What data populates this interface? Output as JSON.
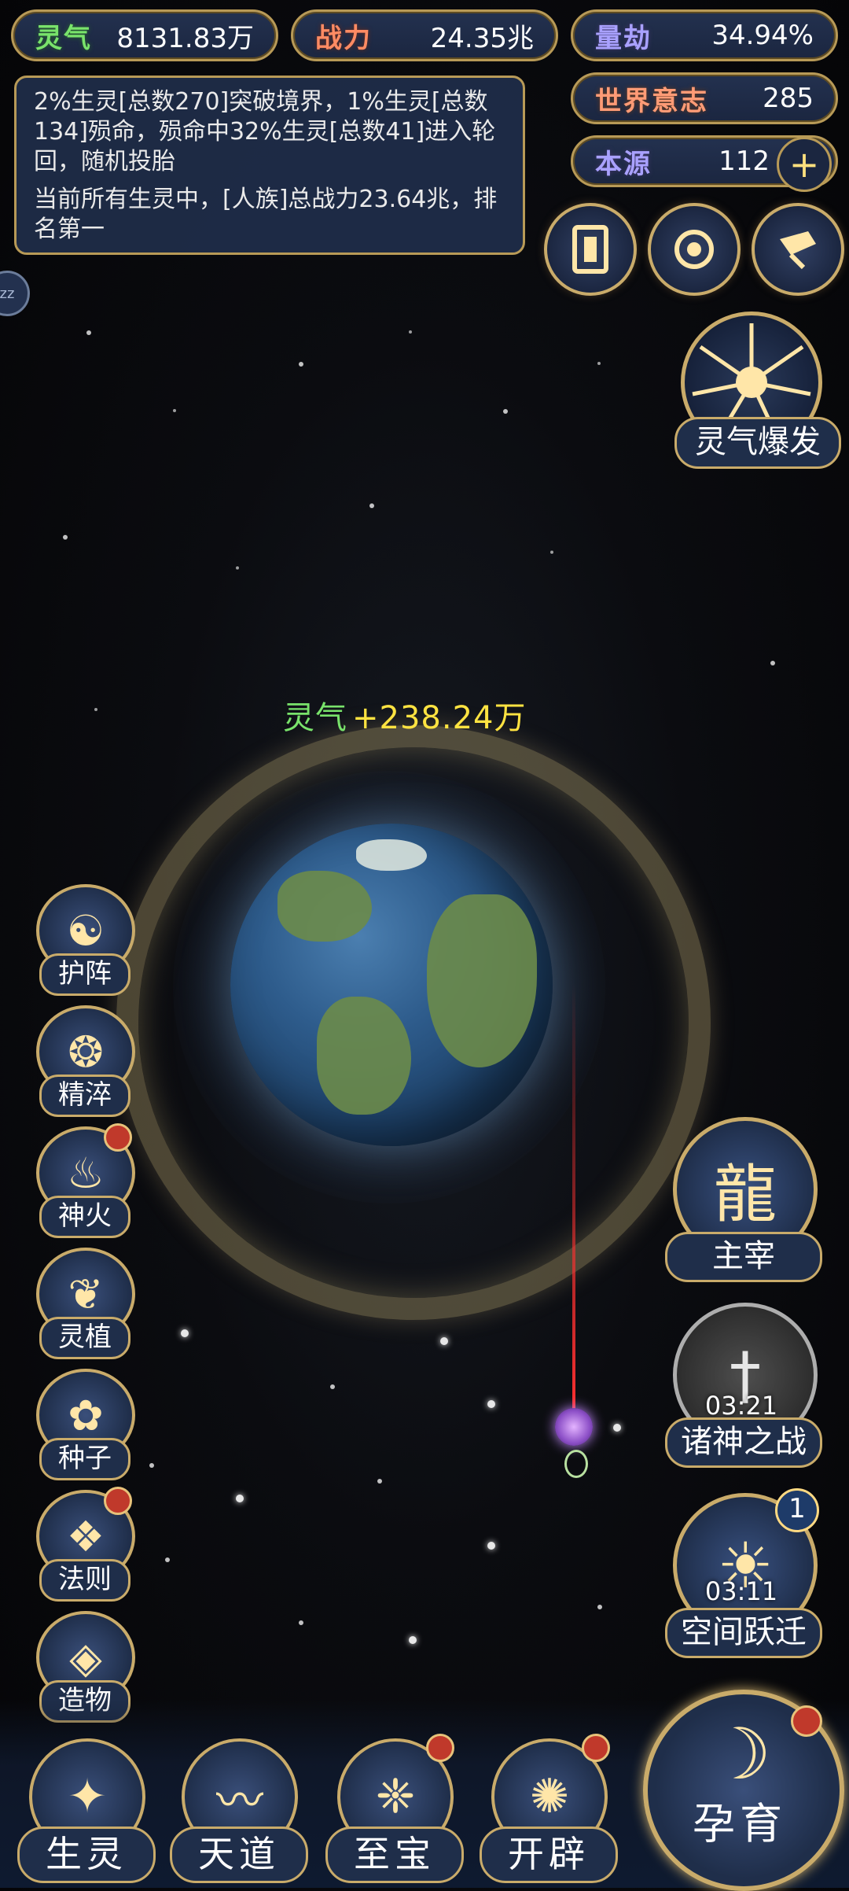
{
  "stats": {
    "lingqi": {
      "label": "灵气",
      "value": "8131.83万"
    },
    "zhanli": {
      "label": "战力",
      "value": "24.35兆"
    },
    "liangjie": {
      "label": "量劫",
      "value": "34.94%"
    },
    "world_will": {
      "label": "世界意志",
      "value": "285"
    },
    "benyuan": {
      "label": "本源",
      "value": "112"
    }
  },
  "info": {
    "line1": "2%生灵[总数270]突破境界，1%生灵[总数134]殒命，殒命中32%生灵[总数41]进入轮回，随机投胎",
    "line2": "当前所有生灵中，[人族]总战力23.64兆，排名第一"
  },
  "floating_gain": {
    "label": "灵气",
    "value": "+238.24万"
  },
  "burst": {
    "label": "灵气爆发"
  },
  "side_menu": [
    {
      "label": "护阵"
    },
    {
      "label": "精淬"
    },
    {
      "label": "神火"
    },
    {
      "label": "灵植"
    },
    {
      "label": "种子"
    },
    {
      "label": "法则"
    },
    {
      "label": "造物"
    }
  ],
  "right_menu": {
    "zhuzai": {
      "label": "主宰"
    },
    "zhushen": {
      "label": "诸神之战",
      "timer": "03:21"
    },
    "kongjian": {
      "label": "空间跃迁",
      "timer": "03:11",
      "badge": "1"
    }
  },
  "bottom_nav": [
    {
      "label": "生灵"
    },
    {
      "label": "天道"
    },
    {
      "label": "至宝"
    },
    {
      "label": "开辟"
    }
  ],
  "incubate": {
    "label": "孕育"
  },
  "side_tab": {
    "text": "zz"
  }
}
